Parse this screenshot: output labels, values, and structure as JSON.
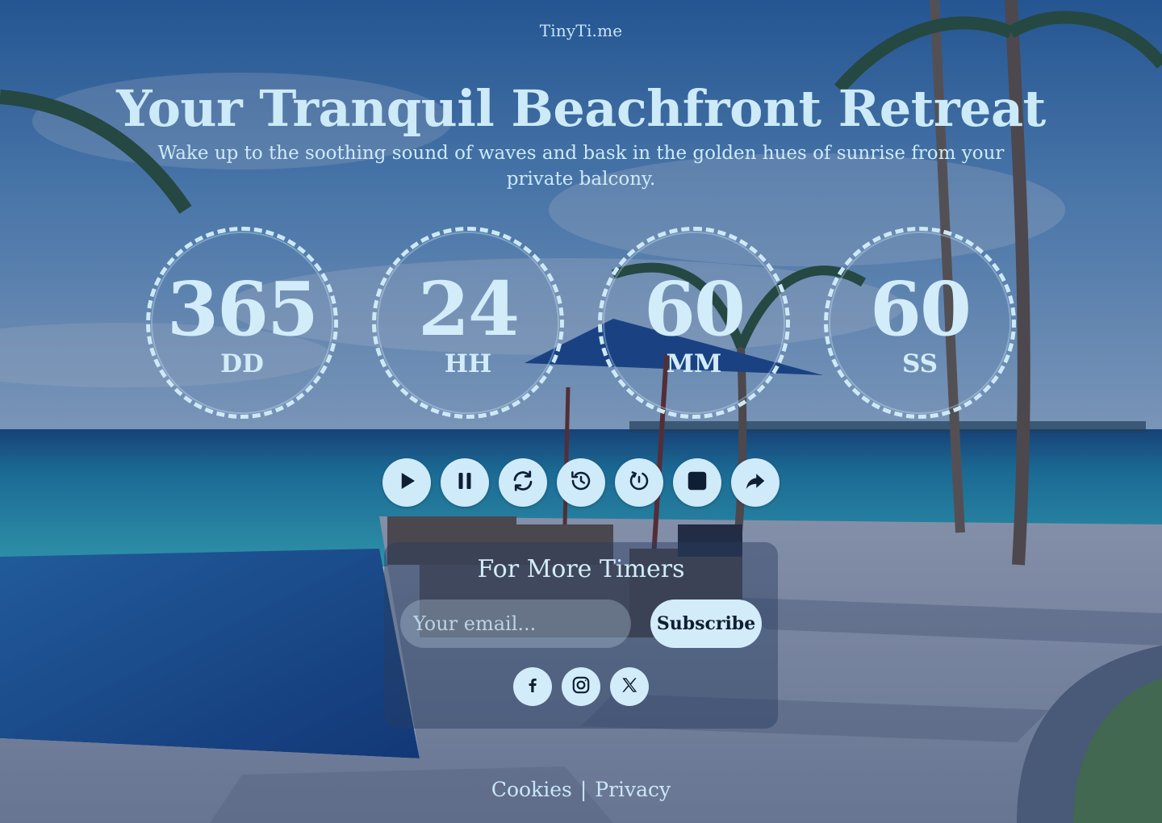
{
  "brand": "TinyTi.me",
  "hero": {
    "title": "Your Tranquil Beachfront Retreat",
    "subtitle": "Wake up to the soothing sound of waves and bask in the golden hues of sunrise from your private balcony."
  },
  "timers": [
    {
      "value": "365",
      "unit": "DD"
    },
    {
      "value": "24",
      "unit": "HH"
    },
    {
      "value": "60",
      "unit": "MM"
    },
    {
      "value": "60",
      "unit": "SS"
    }
  ],
  "controls": [
    "play-icon",
    "pause-icon",
    "refresh-icon",
    "history-icon",
    "restart-icon",
    "stop-icon",
    "share-icon"
  ],
  "subscribe": {
    "heading": "For More Timers",
    "email_placeholder": "Your email...",
    "button_label": "Subscribe"
  },
  "social": [
    "facebook-icon",
    "instagram-icon",
    "x-icon"
  ],
  "footer": {
    "cookies": "Cookies",
    "separator": "|",
    "privacy": "Privacy"
  },
  "colors": {
    "accent": "#cfeaf8",
    "button_text": "#0e1f35",
    "overlay": "#142d5f"
  }
}
